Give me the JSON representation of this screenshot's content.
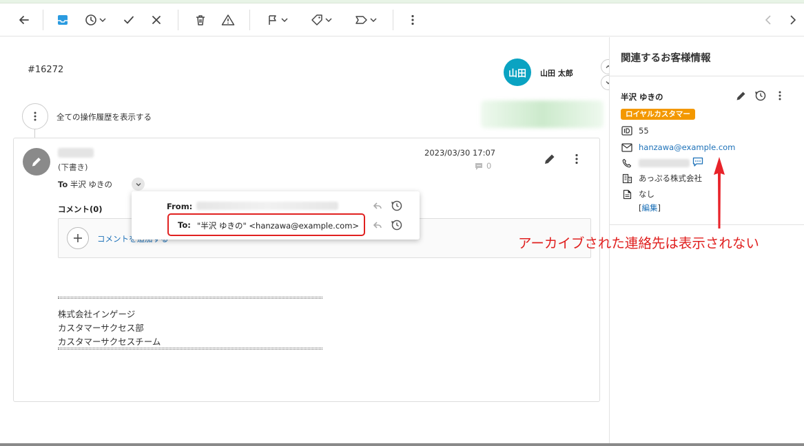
{
  "toolbar": {
    "left_buttons": [
      "back",
      "inbox",
      "snooze",
      "done",
      "close"
    ],
    "mid_buttons": [
      "delete",
      "spam"
    ],
    "right_buttons": [
      "flag",
      "tag",
      "label",
      "more"
    ]
  },
  "ticket": {
    "id": "#16272",
    "assignee_initials": "山田",
    "assignee_name": "山田 太郎",
    "history_label": "全ての操作履歴を表示する"
  },
  "message": {
    "status": "(下書き)",
    "to_label": "To",
    "to_name": "半沢 ゆきの",
    "timestamp": "2023/03/30 17:07",
    "comment_count": "0",
    "comment_heading": "コメント(0)",
    "comment_add_label": "コメントを追加する",
    "signature": [
      "株式会社インゲージ",
      "カスタマーサクセス部",
      "カスタマーサクセスチーム"
    ]
  },
  "popover": {
    "from_label": "From:",
    "to_label": "To:",
    "to_value": "\"半沢 ゆきの\" <hanzawa@example.com>"
  },
  "customer_panel": {
    "title": "関連するお客様情報",
    "name": "半沢 ゆきの",
    "badge": "ロイヤルカスタマー",
    "id": "55",
    "email": "hanzawa@example.com",
    "company": "あっぷる株式会社",
    "memo": "なし",
    "edit_bracket_open": "[",
    "edit_label": "編集",
    "edit_bracket_close": "]"
  },
  "annotation": {
    "text": "アーカイブされた連絡先は表示されない",
    "color": "#e0201f"
  },
  "colors": {
    "accent_link": "#1d71b8",
    "avatar_teal": "#0aa3c2",
    "badge_orange": "#f39800",
    "highlight_red": "#e0201f"
  }
}
